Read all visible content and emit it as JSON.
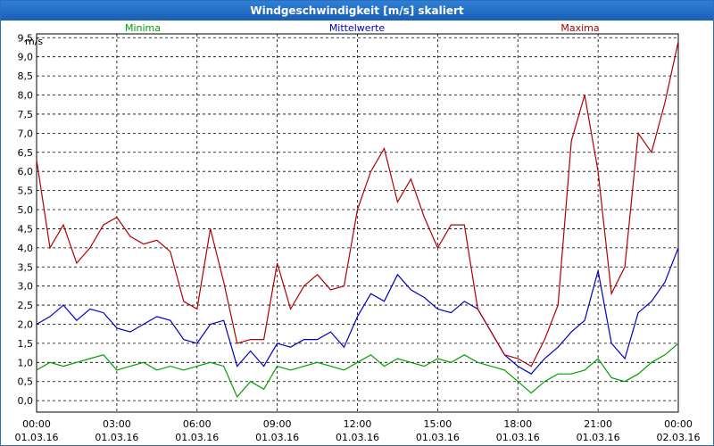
{
  "window": {
    "title": "Windgeschwindigkeit [m/s] skaliert"
  },
  "chart_data": {
    "type": "line",
    "title": "Windgeschwindigkeit [m/s] skaliert",
    "ylabel": "m/s",
    "ylim": [
      -0.3,
      9.6
    ],
    "yticks": [
      0.0,
      0.5,
      1.0,
      1.5,
      2.0,
      2.5,
      3.0,
      3.5,
      4.0,
      4.5,
      5.0,
      5.5,
      6.0,
      6.5,
      7.0,
      7.5,
      8.0,
      8.5,
      9.0,
      9.5
    ],
    "ytick_labels": [
      "0,0",
      "0,5",
      "1,0",
      "1,5",
      "2,0",
      "2,5",
      "3,0",
      "3,5",
      "4,0",
      "4,5",
      "5,0",
      "5,5",
      "6,0",
      "6,5",
      "7,0",
      "7,5",
      "8,0",
      "8,5",
      "9,0",
      "9,5"
    ],
    "xlim_hours": [
      0,
      24
    ],
    "xticks": [
      {
        "t": 0,
        "time": "00:00",
        "date": "01.03.16"
      },
      {
        "t": 3,
        "time": "03:00",
        "date": "01.03.16"
      },
      {
        "t": 6,
        "time": "06:00",
        "date": "01.03.16"
      },
      {
        "t": 9,
        "time": "09:00",
        "date": "01.03.16"
      },
      {
        "t": 12,
        "time": "12:00",
        "date": "01.03.16"
      },
      {
        "t": 15,
        "time": "15:00",
        "date": "01.03.16"
      },
      {
        "t": 18,
        "time": "18:00",
        "date": "01.03.16"
      },
      {
        "t": 21,
        "time": "21:00",
        "date": "01.03.16"
      },
      {
        "t": 24,
        "time": "00:00",
        "date": "02.03.16"
      }
    ],
    "grid": true,
    "legend_placement": "top",
    "series": [
      {
        "name": "Minima",
        "color": "#00a000",
        "x": [
          0,
          0.5,
          1,
          1.5,
          2,
          2.5,
          3,
          3.5,
          4,
          4.5,
          5,
          5.5,
          6,
          6.5,
          7,
          7.5,
          8,
          8.5,
          9,
          9.5,
          10,
          10.5,
          11,
          11.5,
          12,
          12.5,
          13,
          13.5,
          14,
          14.5,
          15,
          15.5,
          16,
          16.5,
          17,
          17.5,
          18,
          18.5,
          19,
          19.5,
          20,
          20.5,
          21,
          21.5,
          22,
          22.5,
          23,
          23.5,
          24
        ],
        "y": [
          0.8,
          1.0,
          0.9,
          1.0,
          1.1,
          1.2,
          0.8,
          0.9,
          1.0,
          0.8,
          0.9,
          0.8,
          0.9,
          1.0,
          0.9,
          0.1,
          0.5,
          0.3,
          0.9,
          0.8,
          0.9,
          1.0,
          0.9,
          0.8,
          1.0,
          1.2,
          0.9,
          1.1,
          1.0,
          0.9,
          1.1,
          1.0,
          1.2,
          1.0,
          0.9,
          0.8,
          0.5,
          0.2,
          0.5,
          0.7,
          0.7,
          0.8,
          1.1,
          0.6,
          0.5,
          0.7,
          1.0,
          1.2,
          1.5
        ]
      },
      {
        "name": "Mittelwerte",
        "color": "#0000c0",
        "x": [
          0,
          0.5,
          1,
          1.5,
          2,
          2.5,
          3,
          3.5,
          4,
          4.5,
          5,
          5.5,
          6,
          6.5,
          7,
          7.5,
          8,
          8.5,
          9,
          9.5,
          10,
          10.5,
          11,
          11.5,
          12,
          12.5,
          13,
          13.5,
          14,
          14.5,
          15,
          15.5,
          16,
          16.5,
          17,
          17.5,
          18,
          18.5,
          19,
          19.5,
          20,
          20.5,
          21,
          21.5,
          22,
          22.5,
          23,
          23.5,
          24
        ],
        "y": [
          2.0,
          2.2,
          2.5,
          2.1,
          2.4,
          2.3,
          1.9,
          1.8,
          2.0,
          2.2,
          2.1,
          1.6,
          1.5,
          2.0,
          2.1,
          0.9,
          1.3,
          0.9,
          1.5,
          1.4,
          1.6,
          1.6,
          1.8,
          1.4,
          2.2,
          2.8,
          2.6,
          3.3,
          2.9,
          2.7,
          2.4,
          2.3,
          2.6,
          2.4,
          1.8,
          1.2,
          0.9,
          0.7,
          1.1,
          1.4,
          1.8,
          2.1,
          3.4,
          1.5,
          1.1,
          2.3,
          2.6,
          3.1,
          4.0
        ]
      },
      {
        "name": "Maxima",
        "color": "#b00000",
        "x": [
          0,
          0.5,
          1,
          1.5,
          2,
          2.5,
          3,
          3.5,
          4,
          4.5,
          5,
          5.5,
          6,
          6.5,
          7,
          7.5,
          8,
          8.5,
          9,
          9.5,
          10,
          10.5,
          11,
          11.5,
          12,
          12.5,
          13,
          13.5,
          14,
          14.5,
          15,
          15.5,
          16,
          16.5,
          17,
          17.5,
          18,
          18.5,
          19,
          19.5,
          20,
          20.5,
          21,
          21.5,
          22,
          22.5,
          23,
          23.5,
          24
        ],
        "y": [
          6.3,
          4.0,
          4.6,
          3.6,
          4.0,
          4.6,
          4.8,
          4.3,
          4.1,
          4.2,
          3.9,
          2.6,
          2.4,
          4.5,
          3.1,
          1.5,
          1.6,
          1.6,
          3.6,
          2.4,
          3.0,
          3.3,
          2.9,
          3.0,
          5.0,
          6.0,
          6.6,
          5.2,
          5.8,
          4.8,
          4.0,
          4.6,
          4.6,
          2.4,
          1.8,
          1.2,
          1.1,
          0.9,
          1.6,
          2.5,
          6.8,
          8.0,
          6.0,
          2.8,
          3.5,
          7.0,
          6.5,
          7.8,
          9.4
        ]
      }
    ]
  }
}
